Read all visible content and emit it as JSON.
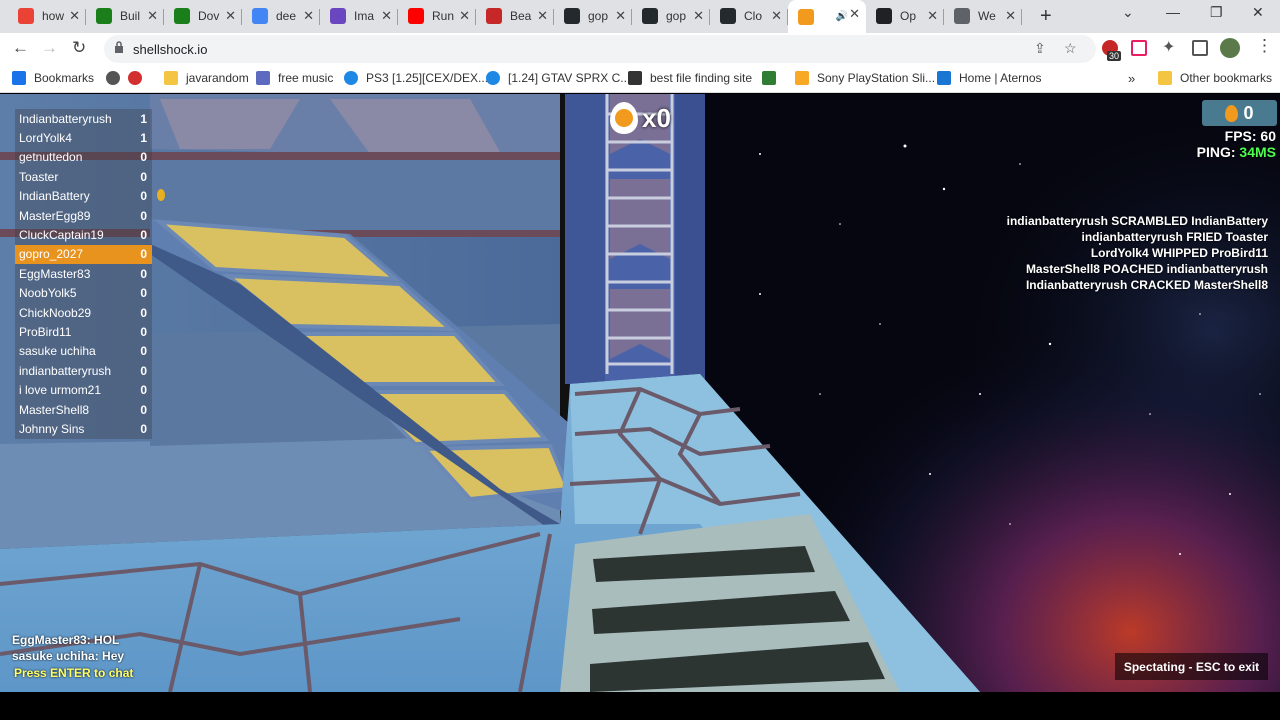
{
  "browser": {
    "tabs": [
      {
        "title": "how",
        "icon": "google-icon",
        "color": "#ea4335"
      },
      {
        "title": "Buil",
        "icon": "green-app-icon",
        "color": "#1a7f1a"
      },
      {
        "title": "Dov",
        "icon": "green-app-icon",
        "color": "#1a7f1a"
      },
      {
        "title": "dee",
        "icon": "google-g-icon",
        "color": "#4285f4"
      },
      {
        "title": "Ima",
        "icon": "chart-icon",
        "color": "#6b46c1"
      },
      {
        "title": "Run",
        "icon": "youtube-icon",
        "color": "#ff0000"
      },
      {
        "title": "Bea",
        "icon": "m-icon",
        "color": "#c62828"
      },
      {
        "title": "gop",
        "icon": "github-icon",
        "color": "#24292e"
      },
      {
        "title": "gop",
        "icon": "github-icon",
        "color": "#24292e"
      },
      {
        "title": "Clo",
        "icon": "github-icon",
        "color": "#24292e"
      },
      {
        "title": "",
        "icon": "shellshock-icon",
        "color": "#f29a1d",
        "active": true
      },
      {
        "title": "Op",
        "icon": "openai-icon",
        "color": "#202124"
      },
      {
        "title": "We",
        "icon": "globe-icon",
        "color": "#5f6368"
      }
    ],
    "url": "shellshock.io",
    "extension_badge": "30",
    "bookmarks": [
      {
        "label": "Bookmarks",
        "icon": "star-icon"
      },
      {
        "label": "",
        "icon": "globe-icon"
      },
      {
        "label": "",
        "icon": "heart-icon"
      },
      {
        "label": "javarandom",
        "icon": "folder-icon"
      },
      {
        "label": "free music",
        "icon": "music-icon"
      },
      {
        "label": "PS3 [1.25][CEX/DEX...",
        "icon": "c-icon"
      },
      {
        "label": "[1.24] GTAV SPRX C...",
        "icon": "c-icon"
      },
      {
        "label": "best file finding site",
        "icon": "folder-dark-icon"
      },
      {
        "label": "",
        "icon": "green-square-icon"
      },
      {
        "label": "Sony PlayStation Sli...",
        "icon": "ps-icon"
      },
      {
        "label": "Home | Aternos",
        "icon": "aternos-icon"
      },
      {
        "label": "Other bookmarks",
        "icon": "folder-icon"
      }
    ]
  },
  "game": {
    "scoreboard": [
      {
        "name": "Indianbatteryrush",
        "score": "1"
      },
      {
        "name": "LordYolk4",
        "score": "1"
      },
      {
        "name": "getnuttedon",
        "score": "0"
      },
      {
        "name": "Toaster",
        "score": "0"
      },
      {
        "name": "IndianBattery",
        "score": "0"
      },
      {
        "name": "MasterEgg89",
        "score": "0"
      },
      {
        "name": "CluckCaptain19",
        "score": "0"
      },
      {
        "name": "gopro_2027",
        "score": "0",
        "me": true
      },
      {
        "name": "EggMaster83",
        "score": "0"
      },
      {
        "name": "NoobYolk5",
        "score": "0"
      },
      {
        "name": "ChickNoob29",
        "score": "0"
      },
      {
        "name": "ProBird11",
        "score": "0"
      },
      {
        "name": "sasuke uchiha",
        "score": "0"
      },
      {
        "name": "indianbatteryrush",
        "score": "0"
      },
      {
        "name": "i love urmom21",
        "score": "0"
      },
      {
        "name": "MasterShell8",
        "score": "0"
      },
      {
        "name": "Johnny Sins",
        "score": "0"
      }
    ],
    "kill_count": "x0",
    "eggs": "0",
    "fps_label": "FPS: 60",
    "ping_label": "PING: ",
    "ping_value": "34MS",
    "kill_feed": [
      "indianbatteryrush SCRAMBLED IndianBattery",
      "indianbatteryrush FRIED Toaster",
      "LordYolk4 WHIPPED ProBird11",
      "MasterShell8 POACHED indianbatteryrush",
      "Indianbatteryrush CRACKED MasterShell8"
    ],
    "chat": [
      "EggMaster83: HOL",
      "sasuke uchiha: Hey"
    ],
    "chat_hint": "Press ENTER to chat",
    "spectating": "Spectating - ESC to exit",
    "colors": {
      "highlight": "#e8931e",
      "ping": "#4cff4c",
      "hint": "#ffff66"
    }
  }
}
